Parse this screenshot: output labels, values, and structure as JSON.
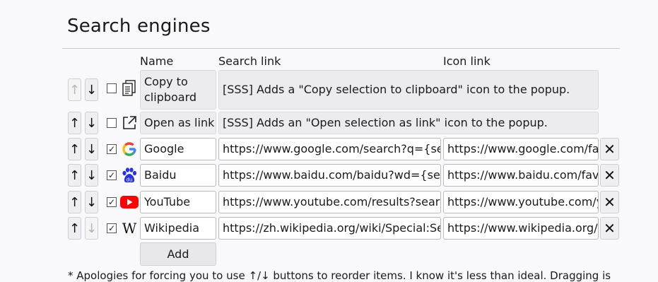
{
  "page": {
    "heading": "Search engines",
    "columns": {
      "name": "Name",
      "search_link": "Search link",
      "icon_link": "Icon link"
    },
    "up_arrow": "↑",
    "down_arrow": "↓",
    "delete_label": "✕",
    "add_label": "Add",
    "footnote": "* Apologies for forcing you to use ↑/↓ buttons to reorder items. I know it's less than ideal. Dragging is"
  },
  "engines": [
    {
      "name": "Copy to clipboard",
      "name_line1": "Copy to",
      "name_line2": "clipboard",
      "description": "[SSS] Adds a \"Copy selection to clipboard\" icon to the popup.",
      "checked": false,
      "icon": "copy-icon",
      "up_disabled": true,
      "down_disabled": false
    },
    {
      "name": "Open as link",
      "description": "[SSS] Adds an \"Open selection as link\" icon to the popup.",
      "checked": false,
      "icon": "external-link-icon",
      "up_disabled": false,
      "down_disabled": false
    },
    {
      "name": "Google",
      "search_link": "https://www.google.com/search?q={sea",
      "icon_link": "https://www.google.com/fa",
      "checked": true,
      "icon": "google-icon",
      "up_disabled": false,
      "down_disabled": false
    },
    {
      "name": "Baidu",
      "search_link": "https://www.baidu.com/baidu?wd={sea",
      "icon_link": "https://www.baidu.com/fav",
      "checked": true,
      "icon": "baidu-icon",
      "up_disabled": false,
      "down_disabled": false
    },
    {
      "name": "YouTube",
      "search_link": "https://www.youtube.com/results?searc",
      "icon_link": "https://www.youtube.com/y",
      "checked": true,
      "icon": "youtube-icon",
      "up_disabled": false,
      "down_disabled": false
    },
    {
      "name": "Wikipedia",
      "search_link": "https://zh.wikipedia.org/wiki/Special:Sea",
      "icon_link": "https://www.wikipedia.org/",
      "checked": true,
      "icon": "wikipedia-icon",
      "up_disabled": false,
      "down_disabled": true
    }
  ],
  "colors": {
    "page_bg": "#f9f9fb",
    "readonly_bg": "#ececee",
    "google": "#4285f4",
    "baidu": "#2932e1",
    "youtube": "#ff0000"
  }
}
